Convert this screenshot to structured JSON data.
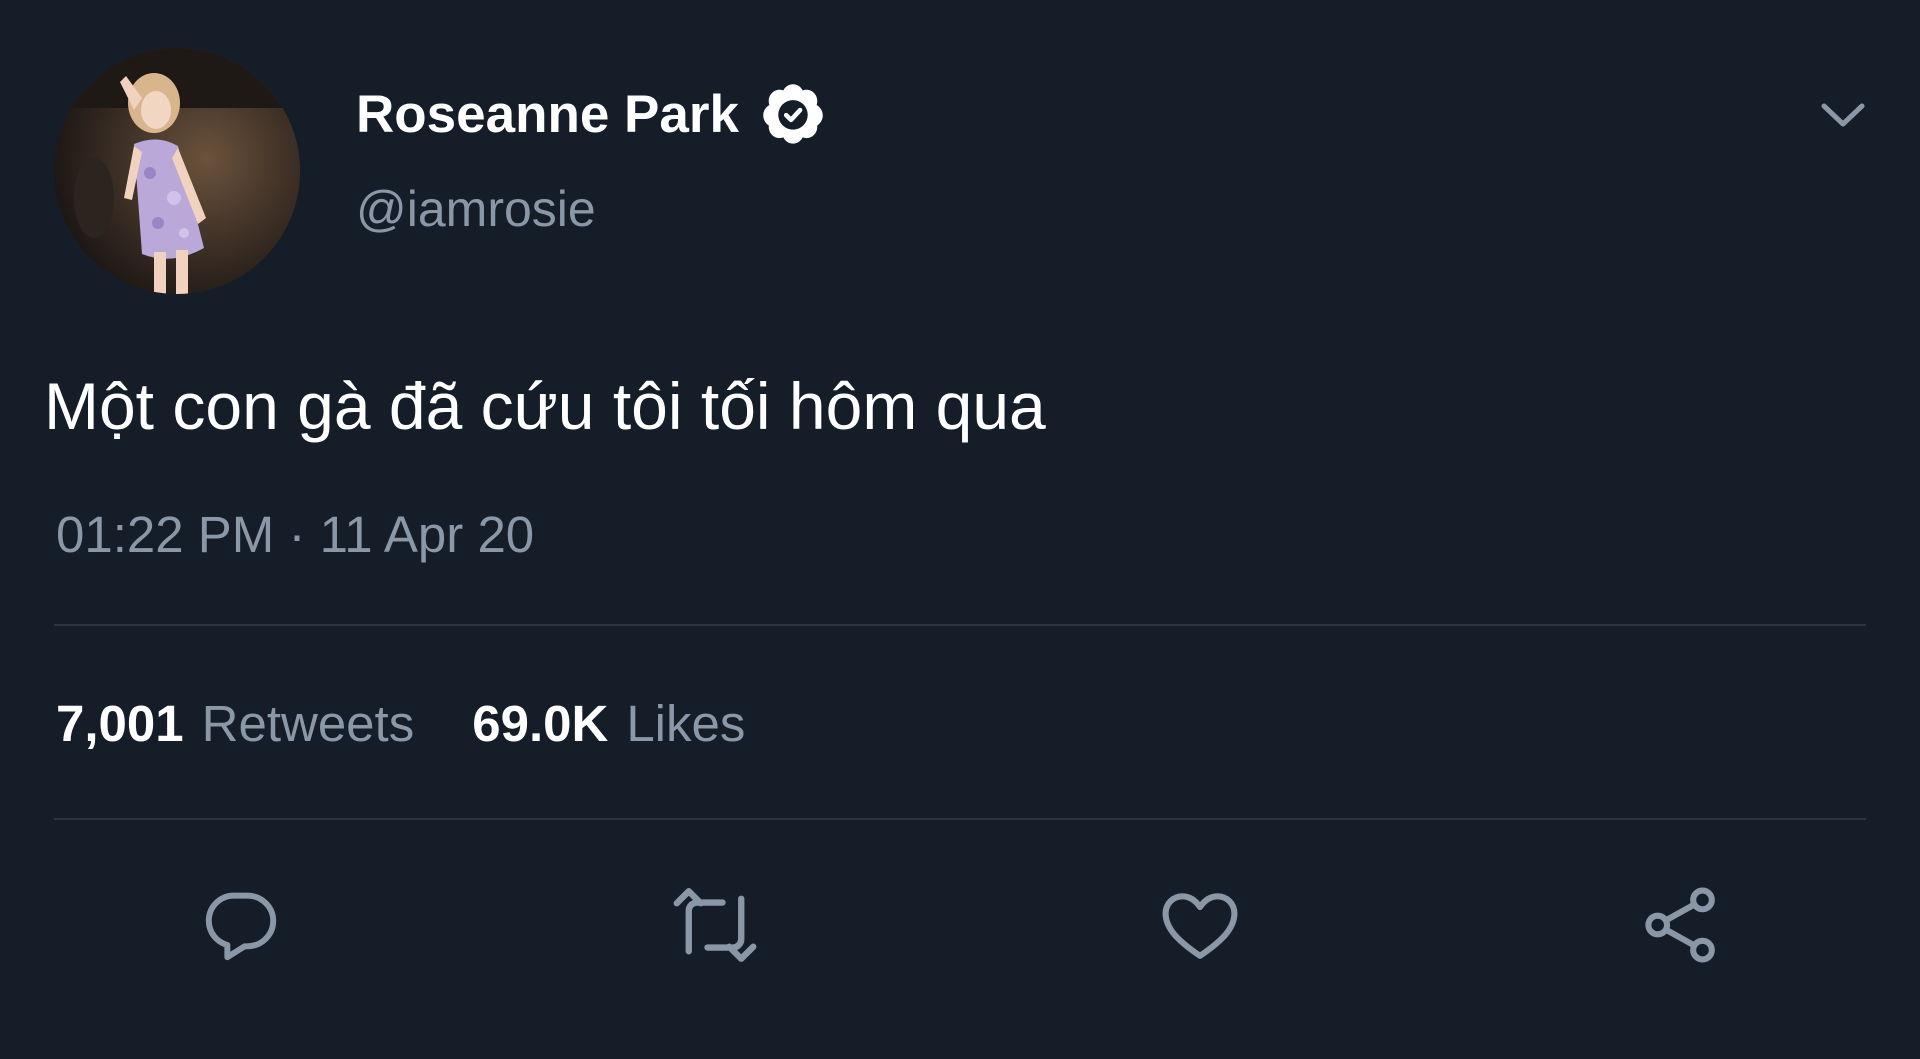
{
  "profile": {
    "display_name": "Roseanne Park",
    "handle": "@iamrosie",
    "verified": true,
    "avatar_icon": "profile-photo"
  },
  "tweet": {
    "text": "Một con gà đã cứu tôi tối hôm qua",
    "timestamp": "01:22 PM · 11 Apr 20"
  },
  "stats": {
    "retweets_count": "7,001",
    "retweets_label": "Retweets",
    "likes_count": "69.0K",
    "likes_label": "Likes"
  },
  "actions": {
    "reply_icon": "reply-icon",
    "retweet_icon": "retweet-icon",
    "like_icon": "heart-icon",
    "share_icon": "share-icon"
  },
  "colors": {
    "background": "#151d29",
    "text_primary": "#ffffff",
    "text_secondary": "#8a97a6",
    "divider": "#2c3643"
  }
}
